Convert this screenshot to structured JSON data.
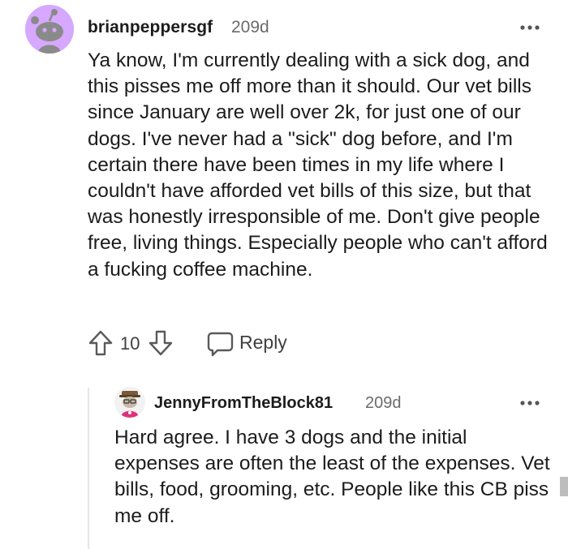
{
  "comment": {
    "username": "brianpeppersgf",
    "age": "209d",
    "avatar_icon": "reddit-snoo-avatar-icon",
    "body": "Ya know, I'm currently dealing with a sick dog, and this pisses me off more than it should. Our vet bills since January are well over 2k, for just one of our dogs. I've never had a \"sick\" dog before, and I'm certain there have been times in my life where I couldn't have afforded vet bills of this size, but that was honestly irresponsible of me. Don't give people free, living things. Especially people who can't afford a fucking coffee machine.",
    "score": "10",
    "reply_label": "Reply"
  },
  "reply": {
    "username": "JennyFromTheBlock81",
    "age": "209d",
    "avatar_icon": "custom-avatar-icon",
    "body": "Hard agree. I have 3 dogs and the initial expenses are often the least of the expenses. Vet bills, food, grooming, etc. People like this CB piss me off."
  },
  "colors": {
    "avatar_bg": "#d6a8ff",
    "text": "#1c1c1c",
    "meta": "#6b6b6b",
    "thread_line": "#e6e6e6"
  }
}
